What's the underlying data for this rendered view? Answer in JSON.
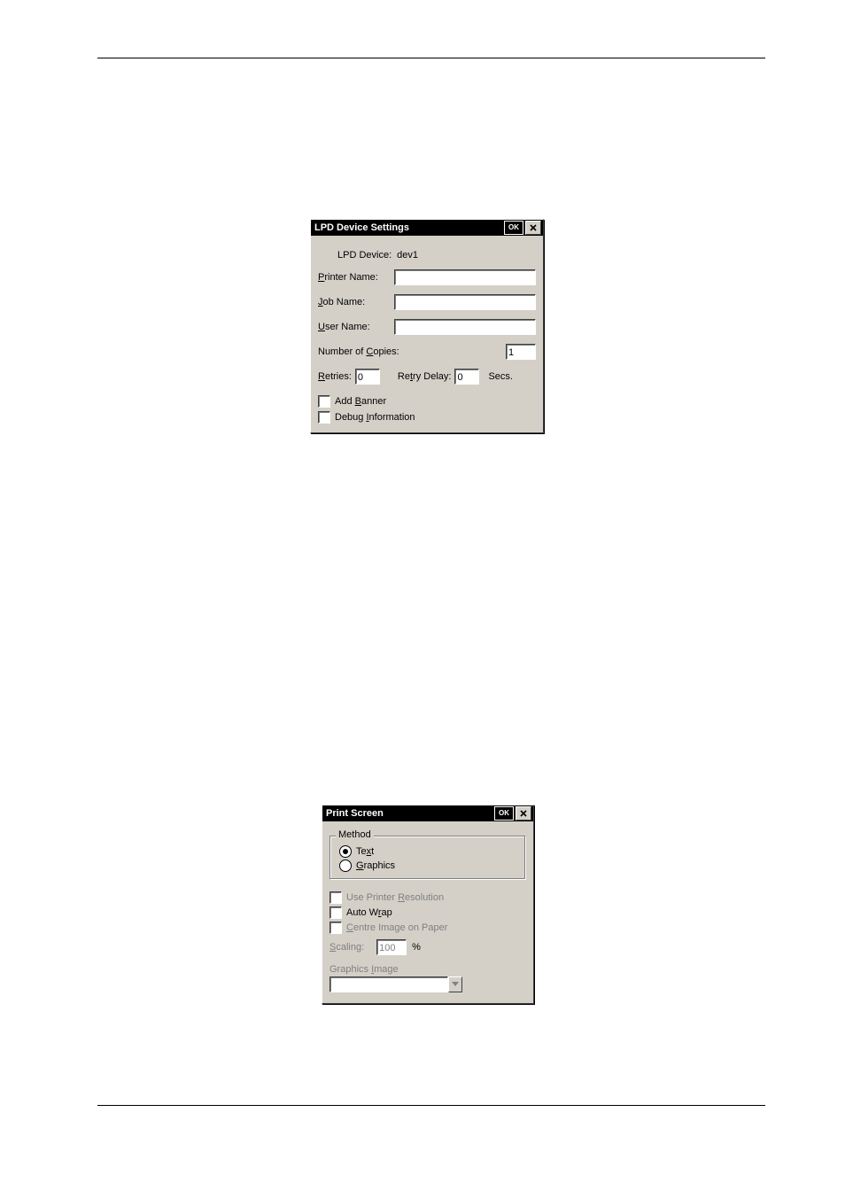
{
  "lpd": {
    "title": "LPD Device Settings",
    "ok_label": "OK",
    "device_label": "LPD Device:",
    "device_value": "dev1",
    "printer_label_pre": "",
    "printer_label_u": "P",
    "printer_label_post": "rinter Name:",
    "printer_value": "",
    "job_label_u": "J",
    "job_label_post": "ob Name:",
    "job_value": "",
    "user_label_u": "U",
    "user_label_post": "ser Name:",
    "user_value": "",
    "copies_label_pre": "Number of ",
    "copies_label_u": "C",
    "copies_label_post": "opies:",
    "copies_value": "1",
    "retries_label_u": "R",
    "retries_label_post": "etries:",
    "retries_value": "0",
    "retry_delay_pre": "Re",
    "retry_delay_u": "t",
    "retry_delay_post": "ry Delay:",
    "retry_delay_value": "0",
    "secs_label": "Secs.",
    "add_banner_pre": "Add ",
    "add_banner_u": "B",
    "add_banner_post": "anner",
    "debug_pre": "Debug ",
    "debug_u": "I",
    "debug_post": "nformation"
  },
  "print": {
    "title": "Print Screen",
    "ok_label": "OK",
    "method_legend": "Method",
    "text_pre": "Te",
    "text_u": "x",
    "text_post": "t",
    "graphics_u": "G",
    "graphics_post": "raphics",
    "use_printer_pre": "Use Printer ",
    "use_printer_u": "R",
    "use_printer_post": "esolution",
    "autowrap_pre": "Auto W",
    "autowrap_u": "r",
    "autowrap_post": "ap",
    "centre_u": "C",
    "centre_post": "entre Image on Paper",
    "scaling_u": "S",
    "scaling_post": "caling:",
    "scaling_value": "100",
    "scaling_pct": "%",
    "gimage_pre": "Graphics ",
    "gimage_u": "I",
    "gimage_post": "mage",
    "gimage_value": ""
  }
}
